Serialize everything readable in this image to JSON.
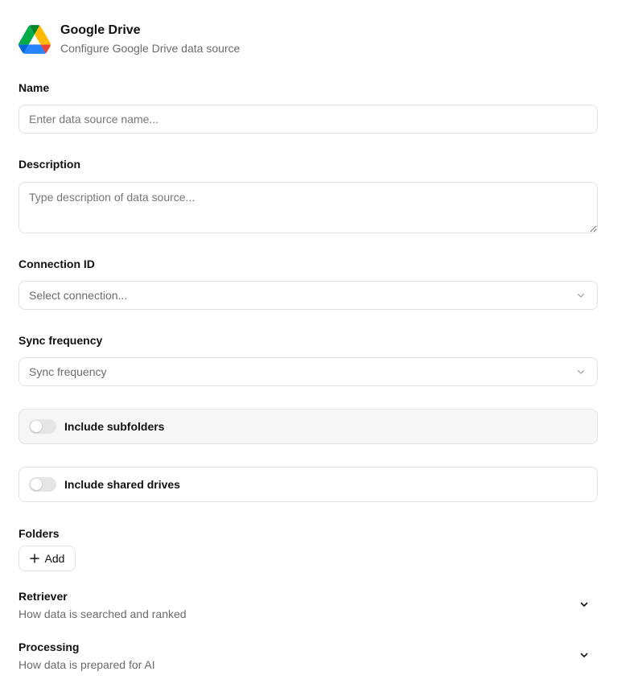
{
  "header": {
    "title": "Google Drive",
    "subtitle": "Configure Google Drive data source",
    "logo_icon": "google-drive-logo"
  },
  "form": {
    "name": {
      "label": "Name",
      "placeholder": "Enter data source name...",
      "value": ""
    },
    "description": {
      "label": "Description",
      "placeholder": "Type description of data source...",
      "value": ""
    },
    "connection": {
      "label": "Connection ID",
      "selected": "Select connection...",
      "icon": "chevron-down-icon"
    },
    "sync": {
      "label": "Sync frequency",
      "selected": "Sync frequency",
      "icon": "chevron-down-icon"
    },
    "include_subfolders": {
      "label": "Include subfolders",
      "enabled": false
    },
    "include_shared_drives": {
      "label": "Include shared drives",
      "enabled": false
    },
    "folders": {
      "label": "Folders",
      "add_label": "Add",
      "add_icon": "plus-icon"
    }
  },
  "sections": {
    "retriever": {
      "title": "Retriever",
      "description": "How data is searched and ranked",
      "expanded": false
    },
    "processing": {
      "title": "Processing",
      "description": "How data is prepared for AI",
      "expanded": false
    }
  },
  "colors": {
    "border": "#e3e3e3",
    "muted_text": "#6b6b6b",
    "switch_off": "#e5e5e5",
    "card_shaded": "#f6f6f6",
    "drive_green": "#0F9D58",
    "drive_yellow": "#F4B400",
    "drive_blue": "#4285F4"
  }
}
